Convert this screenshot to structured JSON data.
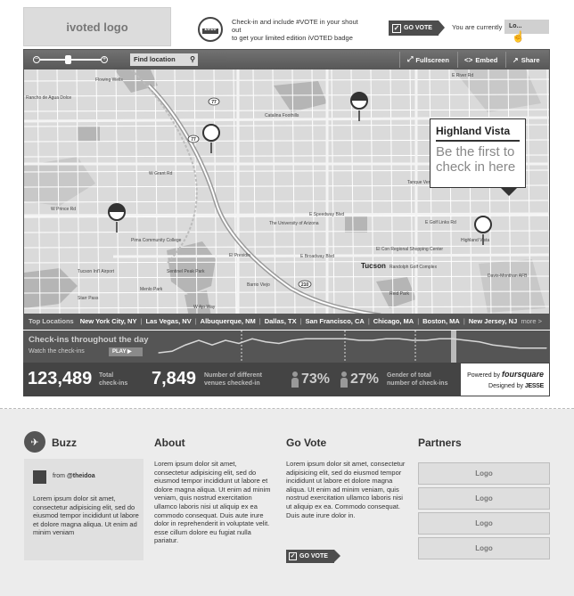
{
  "header": {
    "logo_text": "ivoted logo",
    "badge_year": "2010",
    "checkin_line1": "Check-in and include #VOTE  in your shout out",
    "checkin_line2": "to get your limited edition iVOTED badge",
    "go_vote_label": "GO VOTE",
    "currently_label": "You are currently",
    "location_value": "Lo..."
  },
  "map": {
    "find_location_label": "Find location",
    "fullscreen_label": "Fullscreen",
    "embed_label": "Embed",
    "share_label": "Share",
    "callout_title": "Highland Vista",
    "callout_line1": "Be the first to",
    "callout_line2": "check in here",
    "labels": {
      "tucson": "Tucson",
      "tucson_airport": "Tucson Int'l Airport",
      "university": "The University of Arizona",
      "el_con": "El Con Regional Shopping Center",
      "south_tucson": "South Tucson",
      "catalina_foothills": "Catalina Foothills",
      "oro_valley": "Oro Valley",
      "marana": "Marana",
      "starr_pass": "Starr Pass",
      "pima_college": "Pima Community College",
      "tucson_mall": "Tucson Mall",
      "davis_monthan": "Davis-Monthan AFB",
      "rancho_agua_dolce": "Rancho de Agua Dolce",
      "la_cholla": "La Cholla Hills",
      "flowing_wells": "Flowing Wells",
      "speedway": "E Speedway Blvd",
      "broadway": "E Broadway Blvd",
      "grant_rd": "W Grant Rd",
      "prince_rd": "W Prince Rd",
      "river_rd": "E River Rd",
      "sentinel_peak": "Sentinel Peak Park",
      "highland_vista": "Highland Vista",
      "golf_links": "E Golf Links Rd",
      "22nd_st": "E 22nd St",
      "tanque_verde": "Tanque Verde",
      "el_presidio": "El Presidio",
      "barrio_viejo": "Barrio Viejo",
      "randolph_golf": "Randolph Golf Complex",
      "reid_park": "Reid Park",
      "menlo_park": "Menlo Park",
      "ajo_way": "W Ajo Way",
      "campbell": "N Campbell Ave"
    },
    "top_locations_label": "Top Locations",
    "top_locations": [
      "New York City, NY",
      "Las Vegas, NV",
      "Albuquerque, NM",
      "Dallas, TX",
      "San Francisco, CA",
      "Chicago, MA",
      "Boston, MA",
      "New Jersey, NJ"
    ],
    "more_label": "more >"
  },
  "checkins_chart": {
    "title": "Check-ins throughout the day",
    "subtitle": "Watch the check-ins",
    "play_label": "PLAY"
  },
  "chart_data": {
    "type": "line",
    "title": "Check-ins throughout the day",
    "values": [
      4,
      5,
      9,
      12,
      9,
      12,
      10,
      13,
      11,
      10,
      12,
      13,
      13,
      13,
      13,
      12,
      12,
      13,
      13,
      12,
      12,
      13,
      13,
      12,
      11,
      9,
      8,
      7,
      7,
      7
    ],
    "ylim": [
      0,
      16
    ],
    "grid": false
  },
  "stats": {
    "total_checkins": "123,489",
    "total_checkins_label1": "Total",
    "total_checkins_label2": "check-ins",
    "venues": "7,849",
    "venues_label1": "Number of different",
    "venues_label2": "venues checked-in",
    "male_pct": "73%",
    "female_pct": "27%",
    "gender_label1": "Gender of total",
    "gender_label2": "number of check-ins",
    "powered_by": "Powered by",
    "powered_brand": "foursquare",
    "designed_by": "Designed by",
    "designer_brand": "JESSE"
  },
  "footer": {
    "buzz_title": "Buzz",
    "buzz_from": "from",
    "buzz_handle": "@theidoa",
    "buzz_text": "Lorem ipsum dolor sit amet, consectetur adipisicing elit, sed do eiusmod tempor incididunt ut labore et dolore magna aliqua. Ut enim ad minim veniam",
    "about_title": "About",
    "about_text": "Lorem ipsum dolor sit amet, consectetur adipisicing elit, sed do eiusmod tempor incididunt ut labore et dolore magna aliqua. Ut enim ad minim veniam, quis nostrud exercitation ullamco laboris nisi ut aliquip ex ea commodo consequat. Duis aute irure dolor in reprehenderit in voluptate velit. esse cillum dolore eu fugiat nulla pariatur.",
    "govote_title": "Go Vote",
    "govote_text": "Lorem ipsum dolor sit amet, consectetur adipisicing elit, sed do eiusmod tempor incididunt ut labore et dolore magna aliqua. Ut enim ad minim veniam, quis nostrud exercitation ullamco laboris nisi ut aliquip ex ea. Commodo consequat. Duis aute irure dolor in.",
    "govote_button": "GO VOTE",
    "partners_title": "Partners",
    "partner_logos": [
      "Logo",
      "Logo",
      "Logo",
      "Logo"
    ]
  }
}
